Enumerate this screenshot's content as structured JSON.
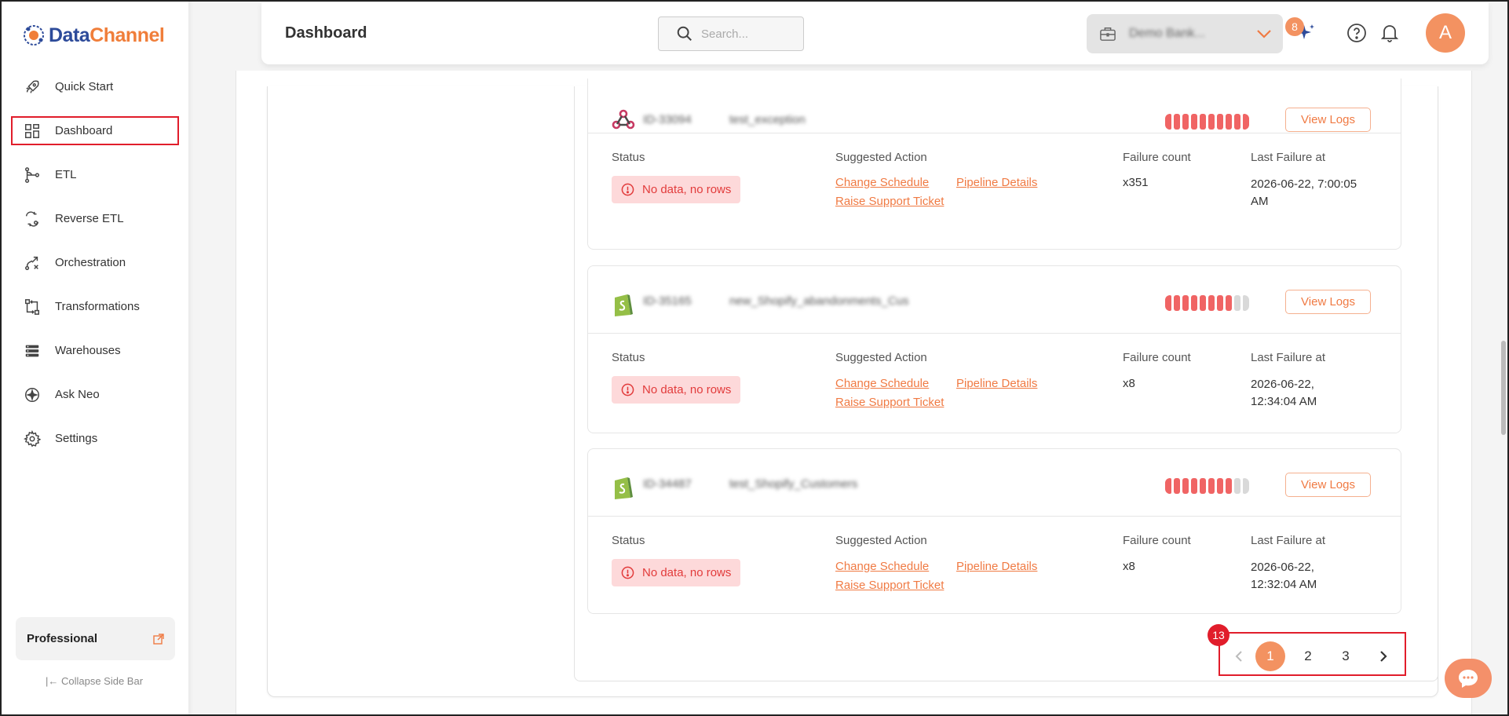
{
  "brand": {
    "part1": "Data",
    "part2": "Channel"
  },
  "sidebar": {
    "items": [
      {
        "label": "Quick Start",
        "icon": "rocket-icon"
      },
      {
        "label": "Dashboard",
        "icon": "dashboard-grid-icon"
      },
      {
        "label": "ETL",
        "icon": "etl-flow-icon"
      },
      {
        "label": "Reverse ETL",
        "icon": "reverse-etl-icon"
      },
      {
        "label": "Orchestration",
        "icon": "orchestration-icon"
      },
      {
        "label": "Transformations",
        "icon": "transformations-icon"
      },
      {
        "label": "Warehouses",
        "icon": "warehouses-icon"
      },
      {
        "label": "Ask Neo",
        "icon": "ask-neo-icon"
      },
      {
        "label": "Settings",
        "icon": "gear-icon"
      }
    ],
    "plan_label": "Professional",
    "collapse_label": "Collapse Side Bar"
  },
  "header": {
    "title": "Dashboard",
    "search_placeholder": "Search...",
    "workspace_name": "Demo Bank...",
    "notification_badge": "8",
    "avatar_initial": "A"
  },
  "colors": {
    "accent": "#f39261",
    "link": "#f07a43",
    "error_bg": "#fdd9da",
    "error_text": "#e23b3b",
    "highlight": "#e11d2b"
  },
  "labels": {
    "status": "Status",
    "suggested_action": "Suggested Action",
    "failure_count": "Failure count",
    "last_failure_at": "Last Failure at",
    "view_logs": "View Logs"
  },
  "pipelines": [
    {
      "source_icon": "webhook-icon",
      "id_text": "ID-33094",
      "name_text": "test_exception",
      "status": "No data, no rows",
      "actions": [
        "Change Schedule",
        "Pipeline Details",
        "Raise Support Ticket"
      ],
      "failure_count": "x351",
      "last_failure_line1": "2026-06-22, 7:00:05",
      "last_failure_line2": "AM"
    },
    {
      "source_icon": "shopify-icon",
      "id_text": "ID-35165",
      "name_text": "new_Shopify_abandonments_Cus",
      "status": "No data, no rows",
      "actions": [
        "Change Schedule",
        "Pipeline Details",
        "Raise Support Ticket"
      ],
      "failure_count": "x8",
      "last_failure_line1": "2026-06-22,",
      "last_failure_line2": "12:34:04 AM"
    },
    {
      "source_icon": "shopify-icon",
      "id_text": "ID-34487",
      "name_text": "test_Shopify_Customers",
      "status": "No data, no rows",
      "actions": [
        "Change Schedule",
        "Pipeline Details",
        "Raise Support Ticket"
      ],
      "failure_count": "x8",
      "last_failure_line1": "2026-06-22,",
      "last_failure_line2": "12:32:04 AM"
    }
  ],
  "pagination": {
    "pages": [
      "1",
      "2",
      "3"
    ],
    "current": "1",
    "annotation_badge": "13"
  }
}
